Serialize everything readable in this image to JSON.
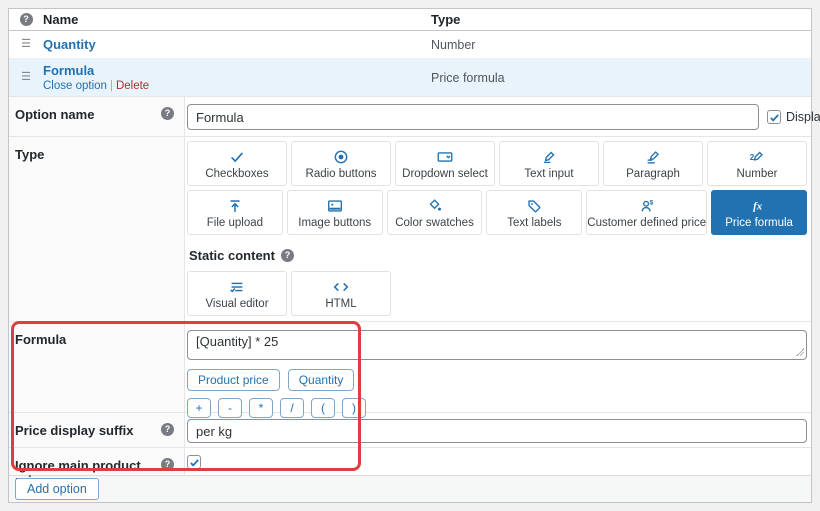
{
  "colors": {
    "accent_blue": "#2271b1",
    "selected_tile_bg": "#2271b1",
    "row_highlight": "#e9f3fb",
    "delete_red": "#b32d2e",
    "annotation_red": "#e03e3e",
    "page_bg": "#f0f0f1"
  },
  "icons": {
    "header_help": "help-icon",
    "row_drag": "drag-handle-icon",
    "tile_icons": [
      "checkmark-icon",
      "radio-icon",
      "dropdown-icon",
      "text-input-pencil-icon",
      "paragraph-pencil-icon",
      "number-pencil-icon",
      "upload-icon",
      "image-icon",
      "color-swatch-icon",
      "tag-icon",
      "person-dollar-icon",
      "fx-icon",
      "visual-editor-icon",
      "code-brackets-icon"
    ]
  },
  "options_table": {
    "header": {
      "name": "Name",
      "type": "Type"
    },
    "rows": [
      {
        "name": "Quantity",
        "type": "Number"
      },
      {
        "name": "Formula",
        "type": "Price formula",
        "close_label": "Close option",
        "separator": "|",
        "delete_label": "Delete"
      }
    ]
  },
  "editor": {
    "option_name": {
      "label": "Option name",
      "value": "Formula",
      "display": {
        "label": "Display",
        "checked": true
      }
    },
    "type_picker": {
      "label": "Type",
      "row1": [
        {
          "label": "Checkboxes"
        },
        {
          "label": "Radio buttons"
        },
        {
          "label": "Dropdown select"
        },
        {
          "label": "Text input"
        },
        {
          "label": "Paragraph"
        },
        {
          "label": "Number"
        }
      ],
      "row2": [
        {
          "label": "File upload"
        },
        {
          "label": "Image buttons"
        },
        {
          "label": "Color swatches"
        },
        {
          "label": "Text labels"
        },
        {
          "label": "Customer defined price"
        },
        {
          "label": "Price formula",
          "selected": true
        }
      ],
      "static_content_label": "Static content",
      "row3": [
        {
          "label": "Visual editor"
        },
        {
          "label": "HTML"
        }
      ]
    },
    "formula": {
      "label": "Formula",
      "value": "[Quantity] * 25",
      "variable_buttons": [
        "Product price",
        "Quantity"
      ],
      "operator_buttons": [
        "+",
        "-",
        "*",
        "/",
        "(",
        ")"
      ]
    },
    "price_display_suffix": {
      "label": "Price display suffix",
      "value": "per kg"
    },
    "ignore_main_product_price": {
      "label": "Ignore main product price",
      "checked": true
    },
    "add_option_label": "Add option"
  }
}
